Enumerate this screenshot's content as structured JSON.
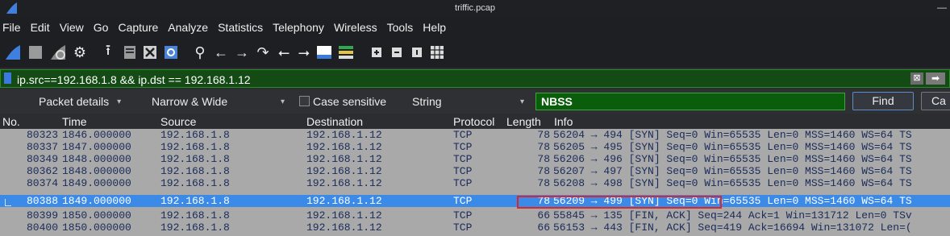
{
  "window": {
    "title": "triffic.pcap"
  },
  "menu": {
    "items": [
      {
        "label": "File"
      },
      {
        "label": "Edit"
      },
      {
        "label": "View"
      },
      {
        "label": "Go"
      },
      {
        "label": "Capture"
      },
      {
        "label": "Analyze"
      },
      {
        "label": "Statistics"
      },
      {
        "label": "Telephony"
      },
      {
        "label": "Wireless"
      },
      {
        "label": "Tools"
      },
      {
        "label": "Help"
      }
    ]
  },
  "toolbar": {
    "icons": [
      "shark-fin-icon",
      "stop-icon",
      "restart-icon",
      "options-icon",
      "open-file-icon",
      "save-file-icon",
      "close-file-icon",
      "reload-icon",
      "search-icon",
      "go-back-icon",
      "go-forward-icon",
      "go-to-packet-icon",
      "first-packet-icon",
      "last-packet-icon",
      "autoscroll-icon",
      "colorize-icon",
      "zoom-in-icon",
      "zoom-out-icon",
      "normal-size-icon",
      "resize-columns-icon"
    ]
  },
  "filter": {
    "value": "ip.src==192.168.1.8 && ip.dst == 192.168.1.12"
  },
  "find": {
    "search_in": "Packet details",
    "char_width": "Narrow & Wide",
    "case_sensitive_label": "Case sensitive",
    "search_type": "String",
    "search_value": "NBSS",
    "find_label": "Find",
    "cancel_label": "Ca"
  },
  "columns": [
    "No.",
    "Time",
    "Source",
    "Destination",
    "Protocol",
    "Length",
    "Info"
  ],
  "packets": [
    {
      "no": "80323",
      "time": "1846.000000",
      "src": "192.168.1.8",
      "dst": "192.168.1.12",
      "proto": "TCP",
      "len": "78",
      "info": "56204 → 494 [SYN] Seq=0 Win=65535 Len=0 MSS=1460 WS=64 TS"
    },
    {
      "no": "80337",
      "time": "1847.000000",
      "src": "192.168.1.8",
      "dst": "192.168.1.12",
      "proto": "TCP",
      "len": "78",
      "info": "56205 → 495 [SYN] Seq=0 Win=65535 Len=0 MSS=1460 WS=64 TS"
    },
    {
      "no": "80349",
      "time": "1848.000000",
      "src": "192.168.1.8",
      "dst": "192.168.1.12",
      "proto": "TCP",
      "len": "78",
      "info": "56206 → 496 [SYN] Seq=0 Win=65535 Len=0 MSS=1460 WS=64 TS"
    },
    {
      "no": "80362",
      "time": "1848.000000",
      "src": "192.168.1.8",
      "dst": "192.168.1.12",
      "proto": "TCP",
      "len": "78",
      "info": "56207 → 497 [SYN] Seq=0 Win=65535 Len=0 MSS=1460 WS=64 TS"
    },
    {
      "no": "80374",
      "time": "1849.000000",
      "src": "192.168.1.8",
      "dst": "192.168.1.12",
      "proto": "TCP",
      "len": "78",
      "info": "56208 → 498 [SYN] Seq=0 Win=65535 Len=0 MSS=1460 WS=64 TS"
    },
    {
      "no": "80388",
      "time": "1849.000000",
      "src": "192.168.1.8",
      "dst": "192.168.1.12",
      "proto": "TCP",
      "len": "78",
      "info": "56209 → 499 [SYN] Seq=0 Win=65535 Len=0 MSS=1460 WS=64 TS"
    },
    {
      "no": "80399",
      "time": "1850.000000",
      "src": "192.168.1.8",
      "dst": "192.168.1.12",
      "proto": "TCP",
      "len": "66",
      "info": "55845 → 135 [FIN, ACK] Seq=244 Ack=1 Win=131712 Len=0 TSv"
    },
    {
      "no": "80400",
      "time": "1850.000000",
      "src": "192.168.1.8",
      "dst": "192.168.1.12",
      "proto": "TCP",
      "len": "66",
      "info": "56153 → 443 [FIN, ACK] Seq=419 Ack=16694 Win=131072 Len=("
    }
  ],
  "selected_index": 5,
  "colors": {
    "selected_row": "#3b8ae8",
    "filter_bg": "#144b14",
    "find_bg": "#0a5d0a",
    "row_bg": "#a9a9a9",
    "highlight": "#e02525"
  }
}
